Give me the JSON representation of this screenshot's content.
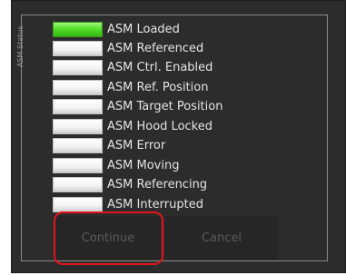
{
  "panel": {
    "group_title": "ASM Status",
    "indicators": [
      {
        "label": "ASM Loaded",
        "active": true
      },
      {
        "label": "ASM Referenced",
        "active": false
      },
      {
        "label": "ASM Ctrl. Enabled",
        "active": false
      },
      {
        "label": "ASM Ref. Position",
        "active": false
      },
      {
        "label": "ASM Target Position",
        "active": false
      },
      {
        "label": "ASM Hood Locked",
        "active": false
      },
      {
        "label": "ASM Error",
        "active": false
      },
      {
        "label": "ASM Moving",
        "active": false
      },
      {
        "label": "ASM Referencing",
        "active": false
      },
      {
        "label": "ASM Interrupted",
        "active": false
      }
    ]
  },
  "buttons": {
    "continue_label": "Continue",
    "cancel_label": "Cancel"
  },
  "colors": {
    "indicator_on": "#4ed825",
    "indicator_off": "#f4f4f4",
    "highlight": "#e0141b"
  }
}
